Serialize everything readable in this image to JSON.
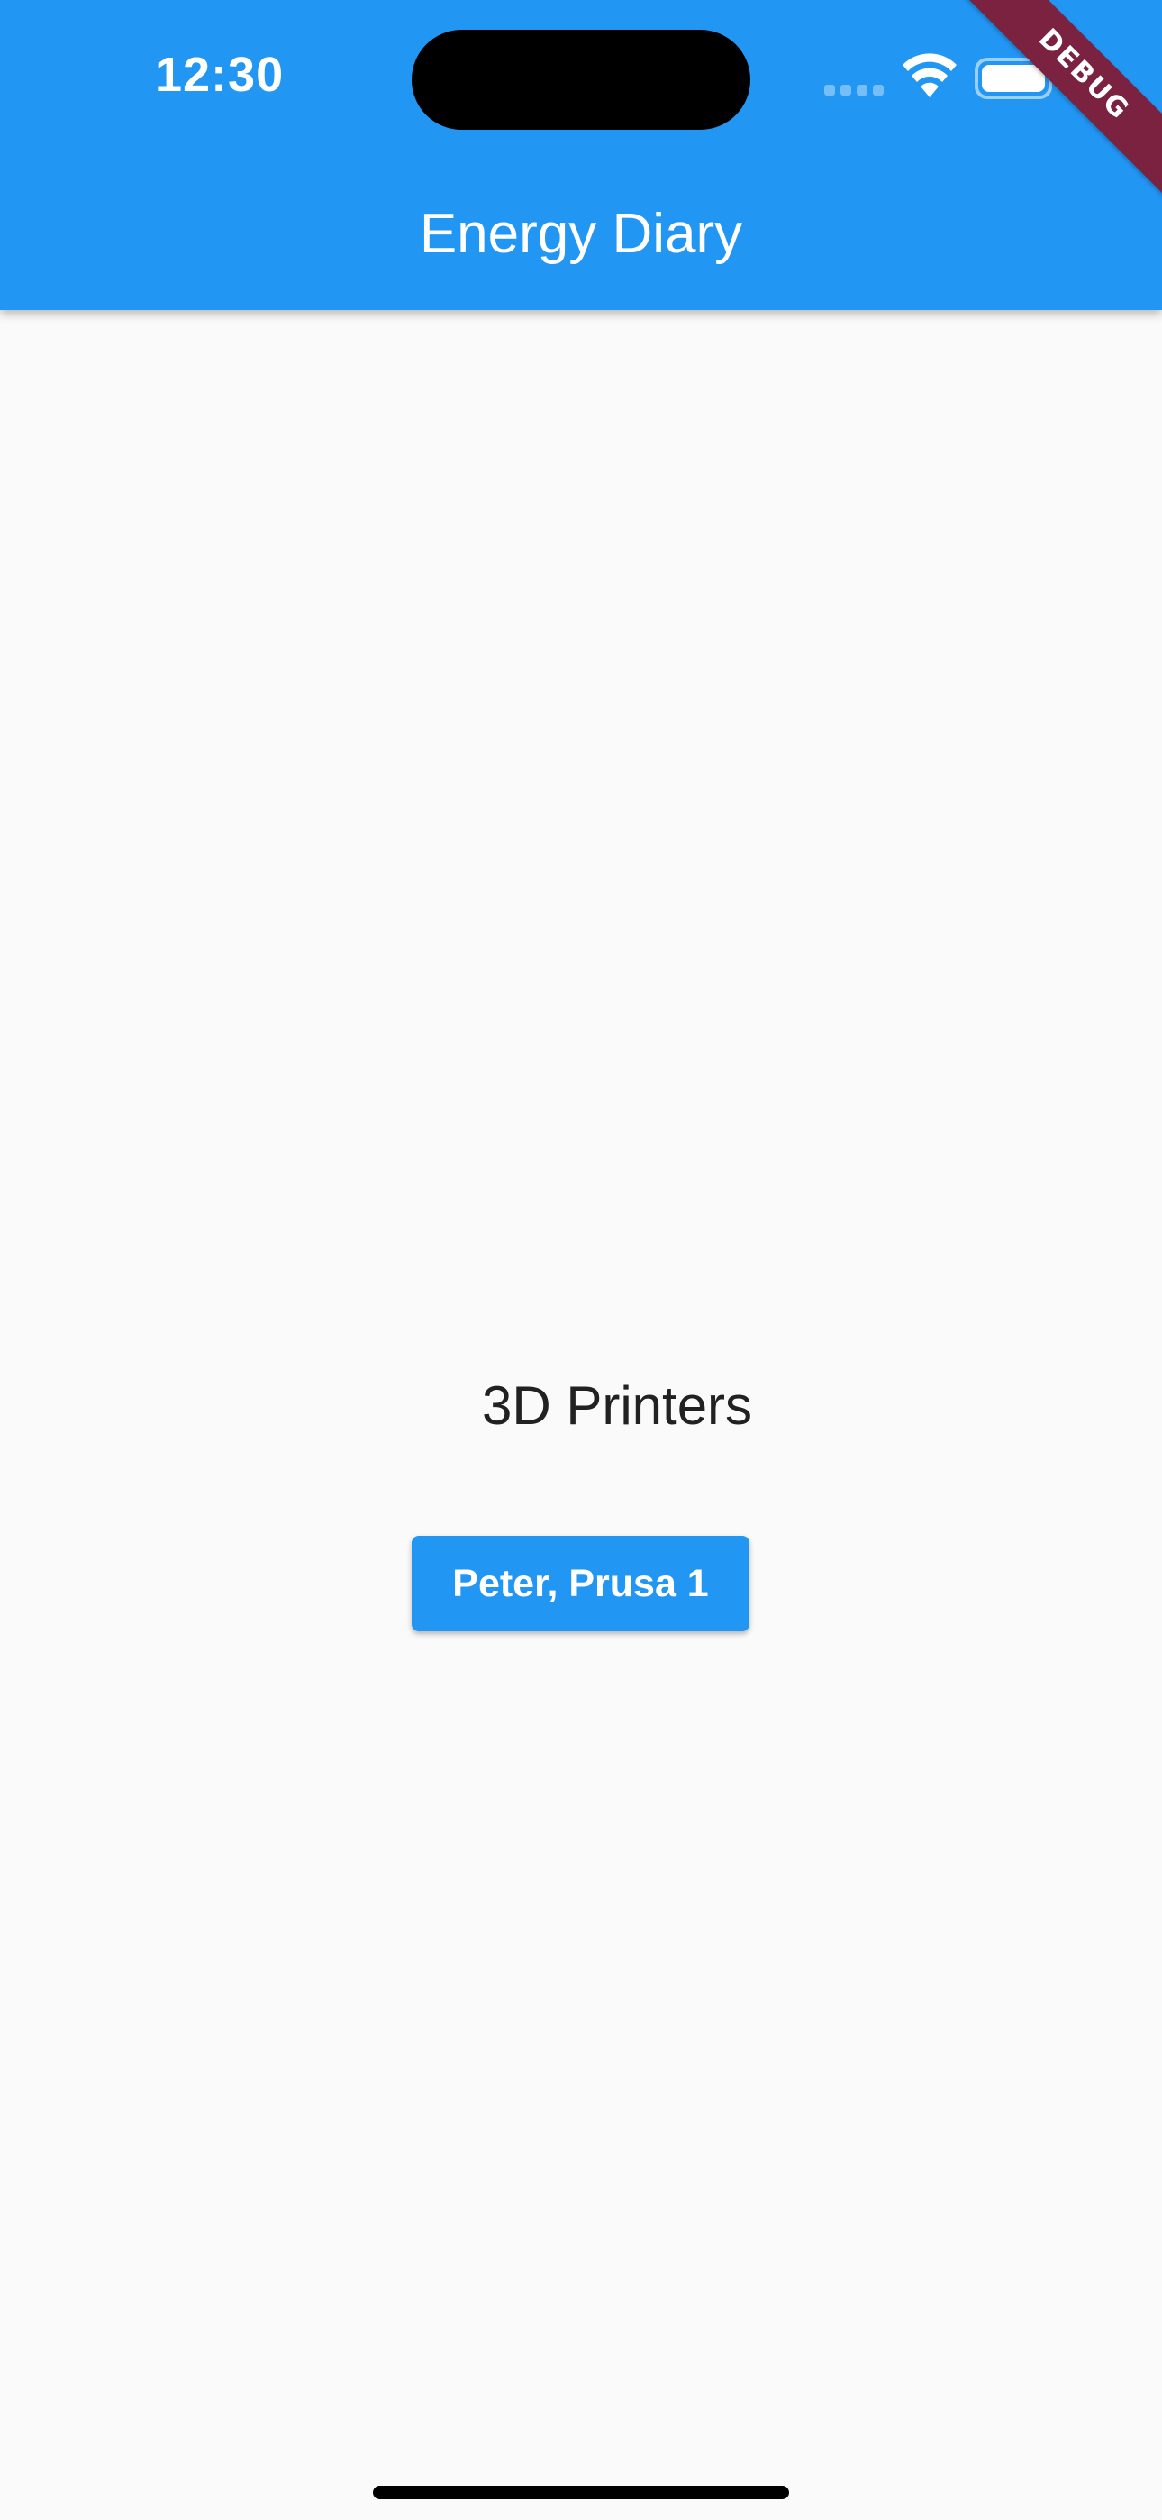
{
  "status_bar": {
    "time": "12:30",
    "icons": [
      "cellular-signal-icon",
      "wifi-icon",
      "battery-icon"
    ]
  },
  "app_bar": {
    "title": "Energy Diary",
    "color": "#2196f3"
  },
  "debug_banner": {
    "label": "DEBUG",
    "color": "#7a2240"
  },
  "main": {
    "section_heading": "3D Printers",
    "printers": [
      {
        "label": "Peter, Prusa 1"
      }
    ]
  }
}
